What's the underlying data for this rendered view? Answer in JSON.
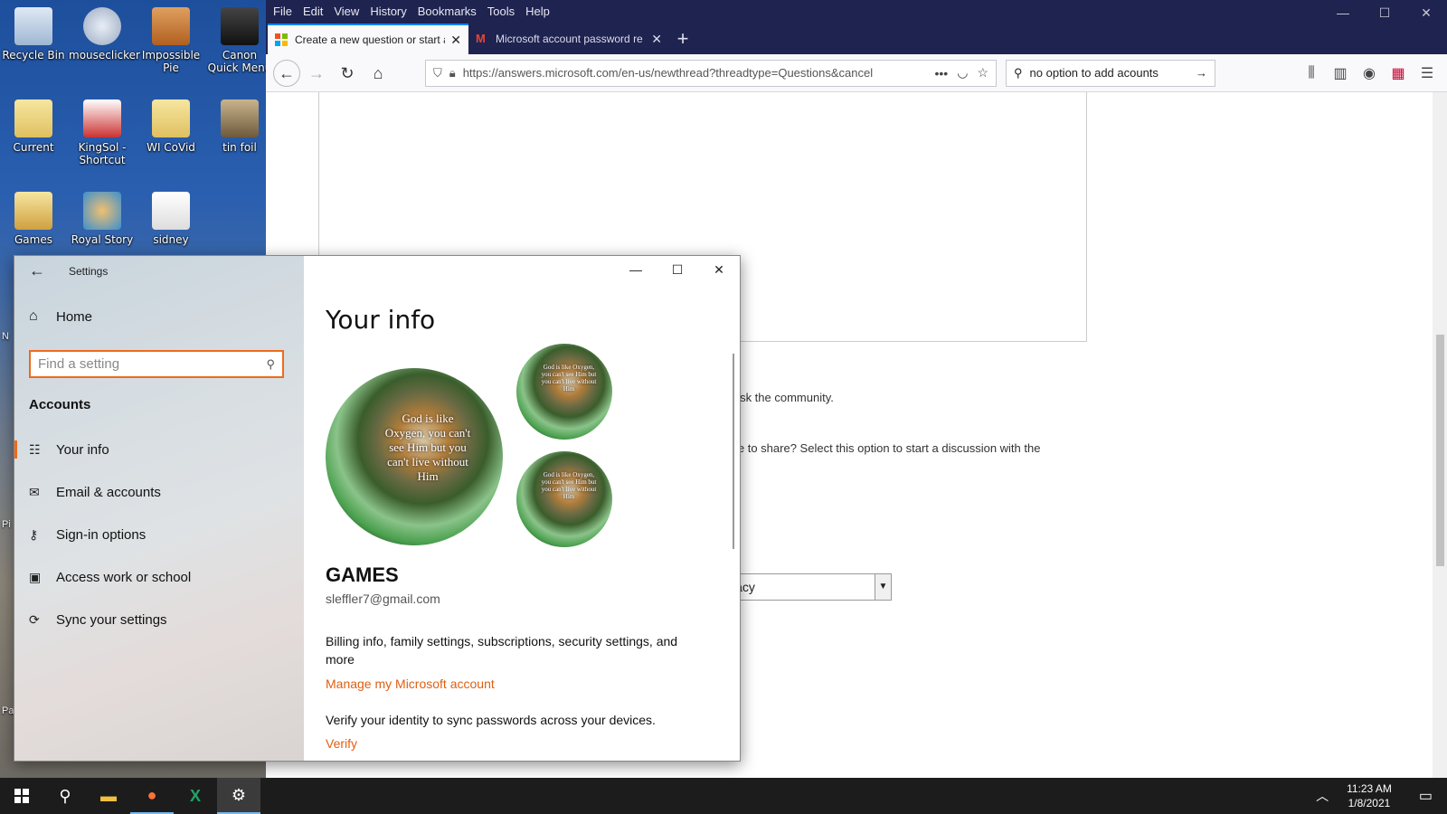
{
  "desktop": {
    "icons": [
      {
        "label": "Recycle Bin"
      },
      {
        "label": "mouseclicker"
      },
      {
        "label": "Impossible Pie"
      },
      {
        "label": "Canon Quick Menu"
      },
      {
        "label": "Current"
      },
      {
        "label": "KingSol - Shortcut"
      },
      {
        "label": "WI CoVid"
      },
      {
        "label": "tin foil"
      },
      {
        "label": "Games"
      },
      {
        "label": "Royal Story"
      },
      {
        "label": "sidney"
      }
    ],
    "edge_labels": [
      "N",
      "Pi",
      "Pa"
    ]
  },
  "firefox": {
    "menu": [
      "File",
      "Edit",
      "View",
      "History",
      "Bookmarks",
      "Tools",
      "Help"
    ],
    "tabs": [
      {
        "label": "Create a new question or start a"
      },
      {
        "label": "Microsoft account password re"
      }
    ],
    "url": "https://answers.microsoft.com/en-us/newthread?threadtype=Questions&cancel",
    "search_value": "no option to add acounts",
    "page": {
      "question_text": "o ask the community.",
      "discussion_text": "vice to share? Select this option to start a discussion with the",
      "required_mark": "*",
      "privacy_select": "ivacy"
    }
  },
  "settings": {
    "title": "Settings",
    "home": "Home",
    "search_placeholder": "Find a setting",
    "section": "Accounts",
    "nav": [
      {
        "label": "Your info"
      },
      {
        "label": "Email & accounts"
      },
      {
        "label": "Sign-in options"
      },
      {
        "label": "Access work or school"
      },
      {
        "label": "Sync your settings"
      }
    ],
    "heading": "Your info",
    "avatar_quote": "God is like Oxygen, you can't see Him but you can't live without Him",
    "name": "GAMES",
    "email": "sleffler7@gmail.com",
    "billing_text": "Billing info, family settings, subscriptions, security settings, and more",
    "manage_link": "Manage my Microsoft account",
    "verify_text": "Verify your identity to sync passwords across your devices.",
    "verify_link": "Verify"
  },
  "taskbar": {
    "time": "11:23 AM",
    "date": "1/8/2021"
  },
  "colors": {
    "accent": "#f06a1a",
    "link": "#e05f12",
    "firefox_chrome": "#1e2350",
    "taskbar": "#1c1c1c"
  }
}
